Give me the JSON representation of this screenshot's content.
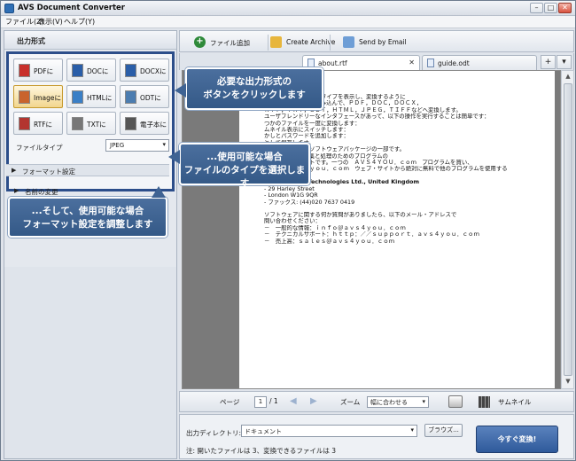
{
  "window": {
    "title": "AVS Document Converter",
    "btn_min": "–",
    "btn_max": "□",
    "btn_close": "✕"
  },
  "menu": {
    "items": [
      "ファイル(Z)",
      "表示(V)",
      "ヘルプ(Y)"
    ]
  },
  "left": {
    "title": "出力形式",
    "formats": [
      {
        "label": "PDFに",
        "icon": "pdf-icon",
        "color": "#c8302b"
      },
      {
        "label": "DOCに",
        "icon": "doc-icon",
        "color": "#2a5ea8"
      },
      {
        "label": "DOCXに",
        "icon": "docx-icon",
        "color": "#2a5ea8"
      },
      {
        "label": "Imageに",
        "icon": "image-icon",
        "color": "#c9632d"
      },
      {
        "label": "HTMLに",
        "icon": "html-icon",
        "color": "#3a7fc6"
      },
      {
        "label": "ODTに",
        "icon": "odt-icon",
        "color": "#4c7db0"
      },
      {
        "label": "RTFに",
        "icon": "rtf-icon",
        "color": "#b3352f"
      },
      {
        "label": "TXTに",
        "icon": "txt-icon",
        "color": "#777777"
      },
      {
        "label": "電子本に",
        "icon": "ebook-icon",
        "color": "#555555"
      }
    ],
    "filetype_label": "ファイルタイプ",
    "filetype_value": "JPEG",
    "format_settings": "フォーマット設定",
    "rename": "名前の変更"
  },
  "toolbar": {
    "add_files": "ファイル追加",
    "create_archive": "Create Archive",
    "send_email": "Send by Email"
  },
  "tabs": [
    {
      "label": "about.rtf"
    },
    {
      "label": "guide.odt"
    }
  ],
  "tab_controls": {
    "add": "+",
    "menu": "▾"
  },
  "document": {
    "lines": [
      "ドキュメントの様々なタイプを表示し、変換するように",
      "メージのファイルを読み込んで、ＰＤＦ，ＤＯＣ，ＤＯＣＸ，",
      "ＲＴＦ，ＴＸＴ，ＯＤＴ，ＨＴＭＬ，ＪＰＥＧ，ＴＩＦＦなどへ変換します。",
      "",
      "ユーザフレンドリーなインタフェースがあって、以下の操作を実行することは簡単です：",
      "",
      "つかのファイルを一度に変換します：",
      "ムネイル表示にスイッチします：",
      "かしとパスワードを追加します：",
      "",
      "として保存します。",
      "",
      "ＹＯＵ．ｃｏｍ　ソフトウェアパッケージの一部です。",
      "ルチメディアの編集と処理のためのプログラムの",
      "完全なツールキットです。一つの　ＡＶＳ４ＹＯＵ．ｃｏｍ　プログラムを買い、",
      "ｗｗｗ．ａｖｓ４ｙｏｕ．ｃｏｍ　ウェブ・サイトから絶対に無料で他のプログラムを使用する",
      "ことができます。",
      ""
    ],
    "company": "Online Media Technologies Ltd., United Kingdom",
    "address": [
      "- 29 Harley Street",
      "- London W1G 9QR",
      "- ファックス: (44)020 7637 0419"
    ],
    "contact_intro": [
      "ソフトウェアに関する何か質問がありましたら、以下のメール・アドレスで",
      "問い合わせください："
    ],
    "contacts": [
      "－　一般的な情報：ｉｎｆｏ＠ａｖｓ４ｙｏｕ．ｃｏｍ",
      "－　テクニカルサポート：ｈｔｔｐ：／／ｓｕｐｐｏｒｔ．ａｖｓ４ｙｏｕ．ｃｏｍ",
      "－　売上高：ｓａｌｅｓ＠ａｖｓ４ｙｏｕ．ｃｏｍ"
    ]
  },
  "pagebar": {
    "page_label": "ページ",
    "page_current": "1",
    "page_total": "/ 1",
    "zoom_label": "ズーム",
    "zoom_value": "幅に合わせる",
    "thumbnails": "サムネイル"
  },
  "bottom": {
    "outdir_label": "出力ディレクトリ:",
    "outdir_value": "ドキュメント",
    "browse": "ブラウズ...",
    "convert": "今すぐ変換!",
    "note": "注: 開いたファイルは 3、変換できるファイルは 3"
  },
  "callouts": {
    "c1": [
      "必要な出力形式の",
      "ボタンをクリックします"
    ],
    "c2": [
      "...使用可能な場合",
      "ファイルのタイプを選択します"
    ],
    "c3": [
      "...そして、使用可能な場合",
      "フォーマット設定を調整します"
    ]
  },
  "colors": {
    "accent": "#2c4e8a",
    "callout": "#3f6393",
    "convert": "#3a64a5"
  }
}
